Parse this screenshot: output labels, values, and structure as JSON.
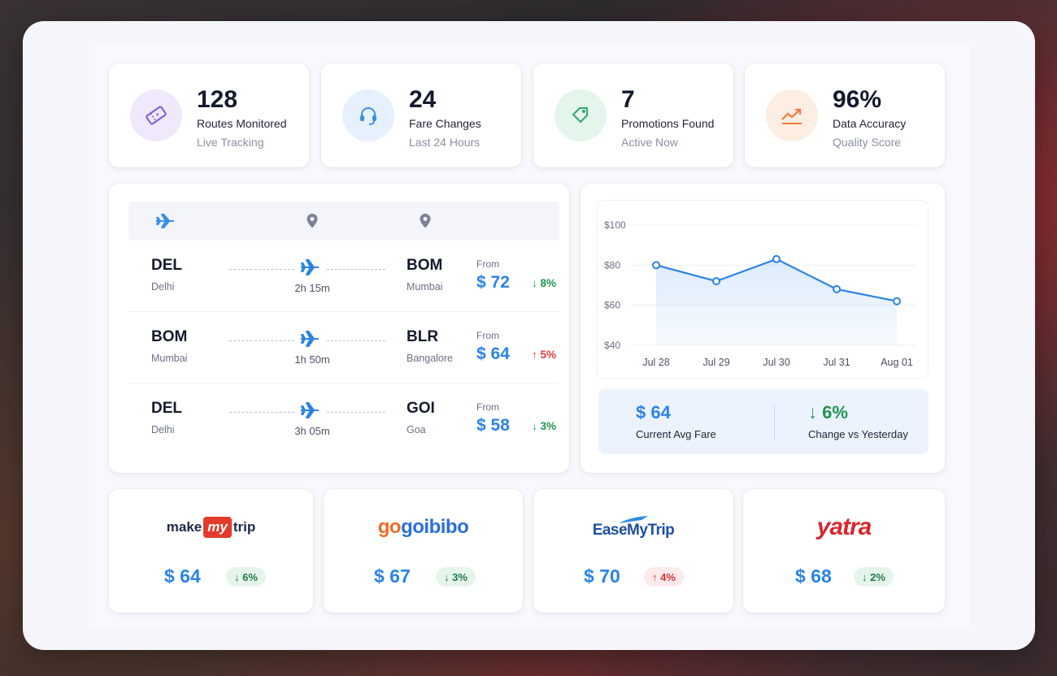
{
  "stats": [
    {
      "value": "128",
      "label": "Routes Monitored",
      "sub": "Live Tracking",
      "icon": "ticket-icon",
      "color": "#7b5bd6",
      "bg": "#efe9fb"
    },
    {
      "value": "24",
      "label": "Fare Changes",
      "sub": "Last 24 Hours",
      "icon": "headset-icon",
      "color": "#3a8ee6",
      "bg": "#e6f1fd"
    },
    {
      "value": "7",
      "label": "Promotions Found",
      "sub": "Active Now",
      "icon": "tag-icon",
      "color": "#2fa870",
      "bg": "#e4f6ec"
    },
    {
      "value": "96%",
      "label": "Data Accuracy",
      "sub": "Quality Score",
      "icon": "trend-up-icon",
      "color": "#ee7a3a",
      "bg": "#fdeee4"
    }
  ],
  "routes": [
    {
      "from_code": "DEL",
      "from_city": "Delhi",
      "to_code": "BOM",
      "to_city": "Mumbai",
      "duration": "2h 15m",
      "from_label": "From",
      "price": "$ 72",
      "change": "8%",
      "direction": "down"
    },
    {
      "from_code": "BOM",
      "from_city": "Mumbai",
      "to_code": "BLR",
      "to_city": "Bangalore",
      "duration": "1h 50m",
      "from_label": "From",
      "price": "$ 64",
      "change": "5%",
      "direction": "up"
    },
    {
      "from_code": "DEL",
      "from_city": "Delhi",
      "to_code": "GOI",
      "to_city": "Goa",
      "duration": "3h 05m",
      "from_label": "From",
      "price": "$ 58",
      "change": "3%",
      "direction": "down"
    }
  ],
  "chart_data": {
    "type": "line",
    "categories": [
      "Jul 28",
      "Jul 29",
      "Jul 30",
      "Jul 31",
      "Aug 01"
    ],
    "series": [
      {
        "values": [
          80,
          72,
          83,
          68,
          62
        ]
      }
    ],
    "yticks": [
      "$100",
      "$80",
      "$60",
      "$40"
    ],
    "ylim": [
      40,
      100
    ],
    "grid": true,
    "color": "#2b83e6"
  },
  "summary": {
    "avg_value": "$ 64",
    "avg_label": "Current Avg Fare",
    "change_value": "6%",
    "change_label": "Change vs Yesterday"
  },
  "providers": [
    {
      "name_a": "make",
      "name_b": "my",
      "name_c": "trip",
      "price": "$ 64",
      "change": "6%",
      "direction": "down"
    },
    {
      "name": "goibibo",
      "price": "$ 67",
      "change": "3%",
      "direction": "down"
    },
    {
      "name": "EaseMyTrip",
      "price": "$ 70",
      "change": "4%",
      "direction": "up"
    },
    {
      "name": "yatra",
      "price": "$ 68",
      "change": "2%",
      "direction": "down"
    }
  ],
  "colors": {
    "accent": "#2b83e6",
    "down": "#1f9650",
    "up": "#e23b3b"
  }
}
